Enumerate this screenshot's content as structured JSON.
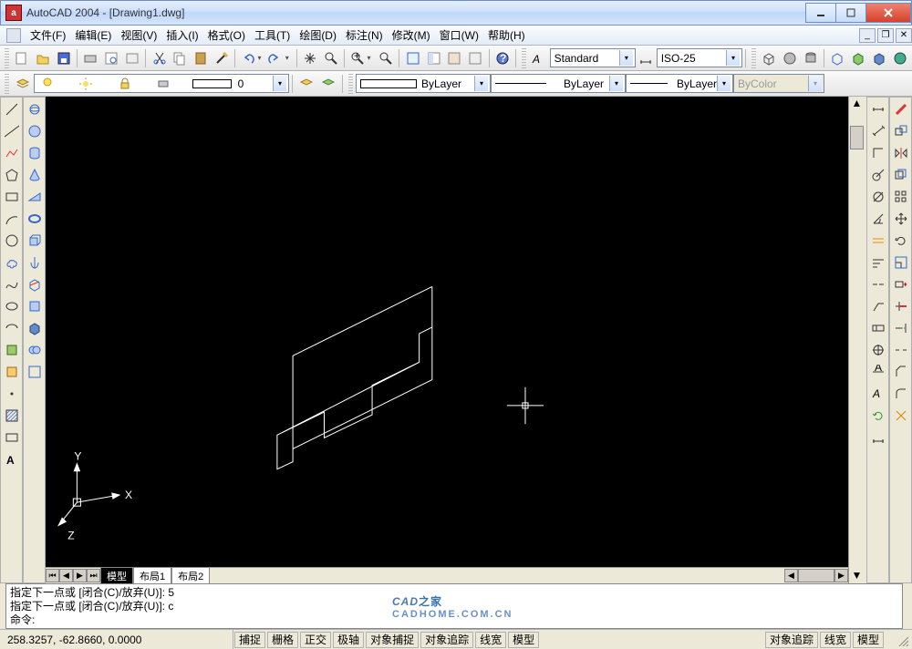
{
  "title": "AutoCAD 2004 - [Drawing1.dwg]",
  "menu": {
    "items": [
      "文件(F)",
      "编辑(E)",
      "视图(V)",
      "插入(I)",
      "格式(O)",
      "工具(T)",
      "绘图(D)",
      "标注(N)",
      "修改(M)",
      "窗口(W)",
      "帮助(H)"
    ]
  },
  "styles": {
    "text_style": "Standard",
    "dim_style": "ISO-25"
  },
  "layers": {
    "current": "0"
  },
  "props": {
    "layer": "ByLayer",
    "color_label": "ByLayer",
    "ltype_label": "ByLayer",
    "bycolor": "ByColor"
  },
  "tabs": {
    "model": "模型",
    "layout1": "布局1",
    "layout2": "布局2"
  },
  "cmd": {
    "line1": "指定下一点或 [闭合(C)/放弃(U)]: 5",
    "line2": "指定下一点或 [闭合(C)/放弃(U)]: c",
    "prompt": "命令:"
  },
  "status": {
    "coords": "258.3257, -62.8660, 0.0000",
    "buttons": [
      "捕捉",
      "栅格",
      "正交",
      "极轴",
      "对象捕捉",
      "对象追踪",
      "线宽",
      "模型"
    ],
    "right": [
      "对象追踪",
      "线宽",
      "模型"
    ]
  },
  "watermark": {
    "text": "CAD之家",
    "url": "CADHOME.COM.CN"
  },
  "ucs": {
    "x": "X",
    "y": "Y",
    "z": "Z"
  }
}
